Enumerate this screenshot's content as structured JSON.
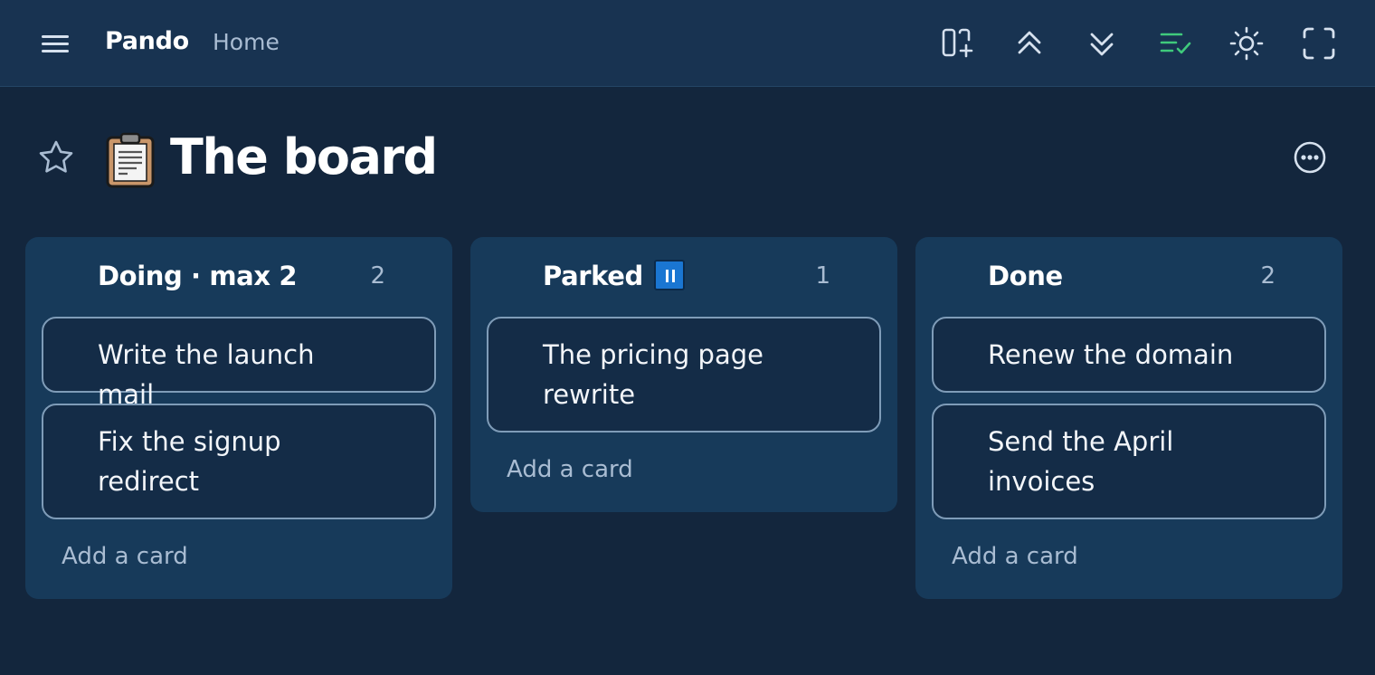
{
  "app": {
    "brand": "Pando",
    "nav_home": "Home"
  },
  "toolbar": {
    "icons": [
      "add-column-icon",
      "collapse-all-icon",
      "expand-all-icon",
      "checklist-icon",
      "theme-sun-icon",
      "fullscreen-icon"
    ],
    "accent_color": "#3fca7c"
  },
  "board": {
    "emoji": "📋",
    "title": "The board"
  },
  "lists": [
    {
      "title": "Doing · max 2",
      "count": "2",
      "cards": [
        "Write the launch mail",
        "Fix the signup redirect"
      ],
      "add_label": "Add a card"
    },
    {
      "title": "Parked",
      "count": "1",
      "cards": [
        "The pricing page rewrite"
      ],
      "add_label": "Add a card",
      "badge": "pause-icon"
    },
    {
      "title": "Done",
      "count": "2",
      "cards": [
        "Renew the domain",
        "Send the April invoices"
      ],
      "add_label": "Add a card"
    }
  ],
  "colors": {
    "background": "#13263d",
    "topbar": "#183351",
    "list": "#173a5a",
    "card": "#142c47",
    "card_border": "#7f9cb8",
    "badge_blue": "#1a76d2"
  }
}
